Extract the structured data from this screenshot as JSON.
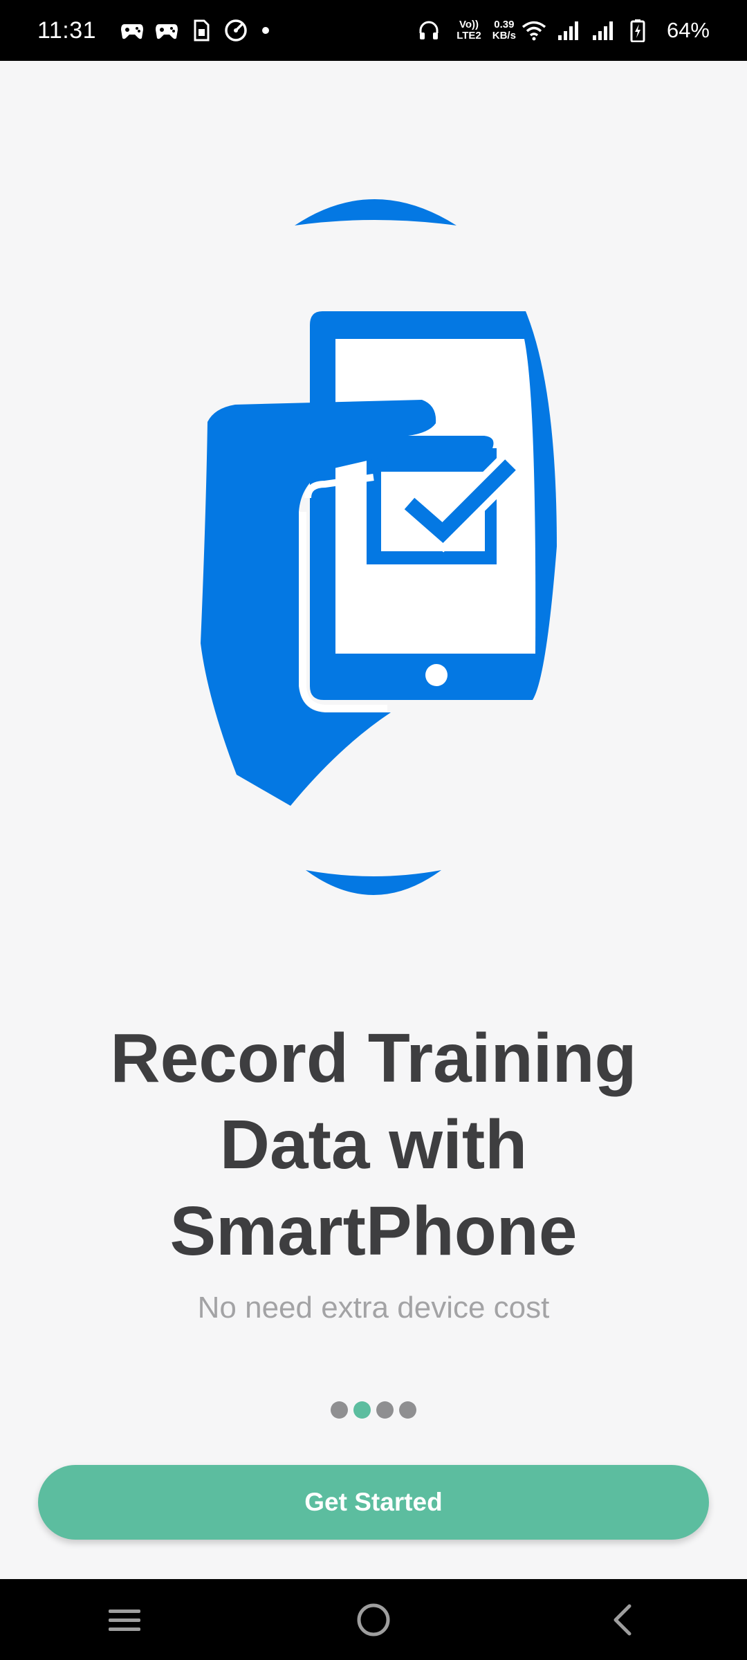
{
  "status_bar": {
    "time": "11:31",
    "network_type": "LTE2",
    "volte_label": "Vo))",
    "data_speed_value": "0.39",
    "data_speed_unit": "KB/s",
    "battery_percent": "64%",
    "icons": [
      "game-controller-icon",
      "game-controller-icon",
      "sim-icon",
      "speedometer-icon",
      "dot-icon",
      "headphones-icon",
      "volte-icon",
      "wifi-icon",
      "signal-icon",
      "signal-icon",
      "battery-charging-icon"
    ]
  },
  "onboarding": {
    "illustration": "hand-holding-phone-checkmark",
    "title_lines": [
      "Record Training",
      "Data with",
      "SmartPhone"
    ],
    "subtitle": "No need extra device cost",
    "pager": {
      "total": 4,
      "active_index": 1
    },
    "cta_label": "Get Started"
  },
  "nav_bar": {
    "icons": [
      "menu-icon",
      "home-icon",
      "back-icon"
    ]
  },
  "colors": {
    "accent": "#5cbd9f",
    "illustration_blue": "#0478e3",
    "title": "#3e3e40",
    "subtitle": "#a3a3a5",
    "background": "#f6f6f7"
  }
}
